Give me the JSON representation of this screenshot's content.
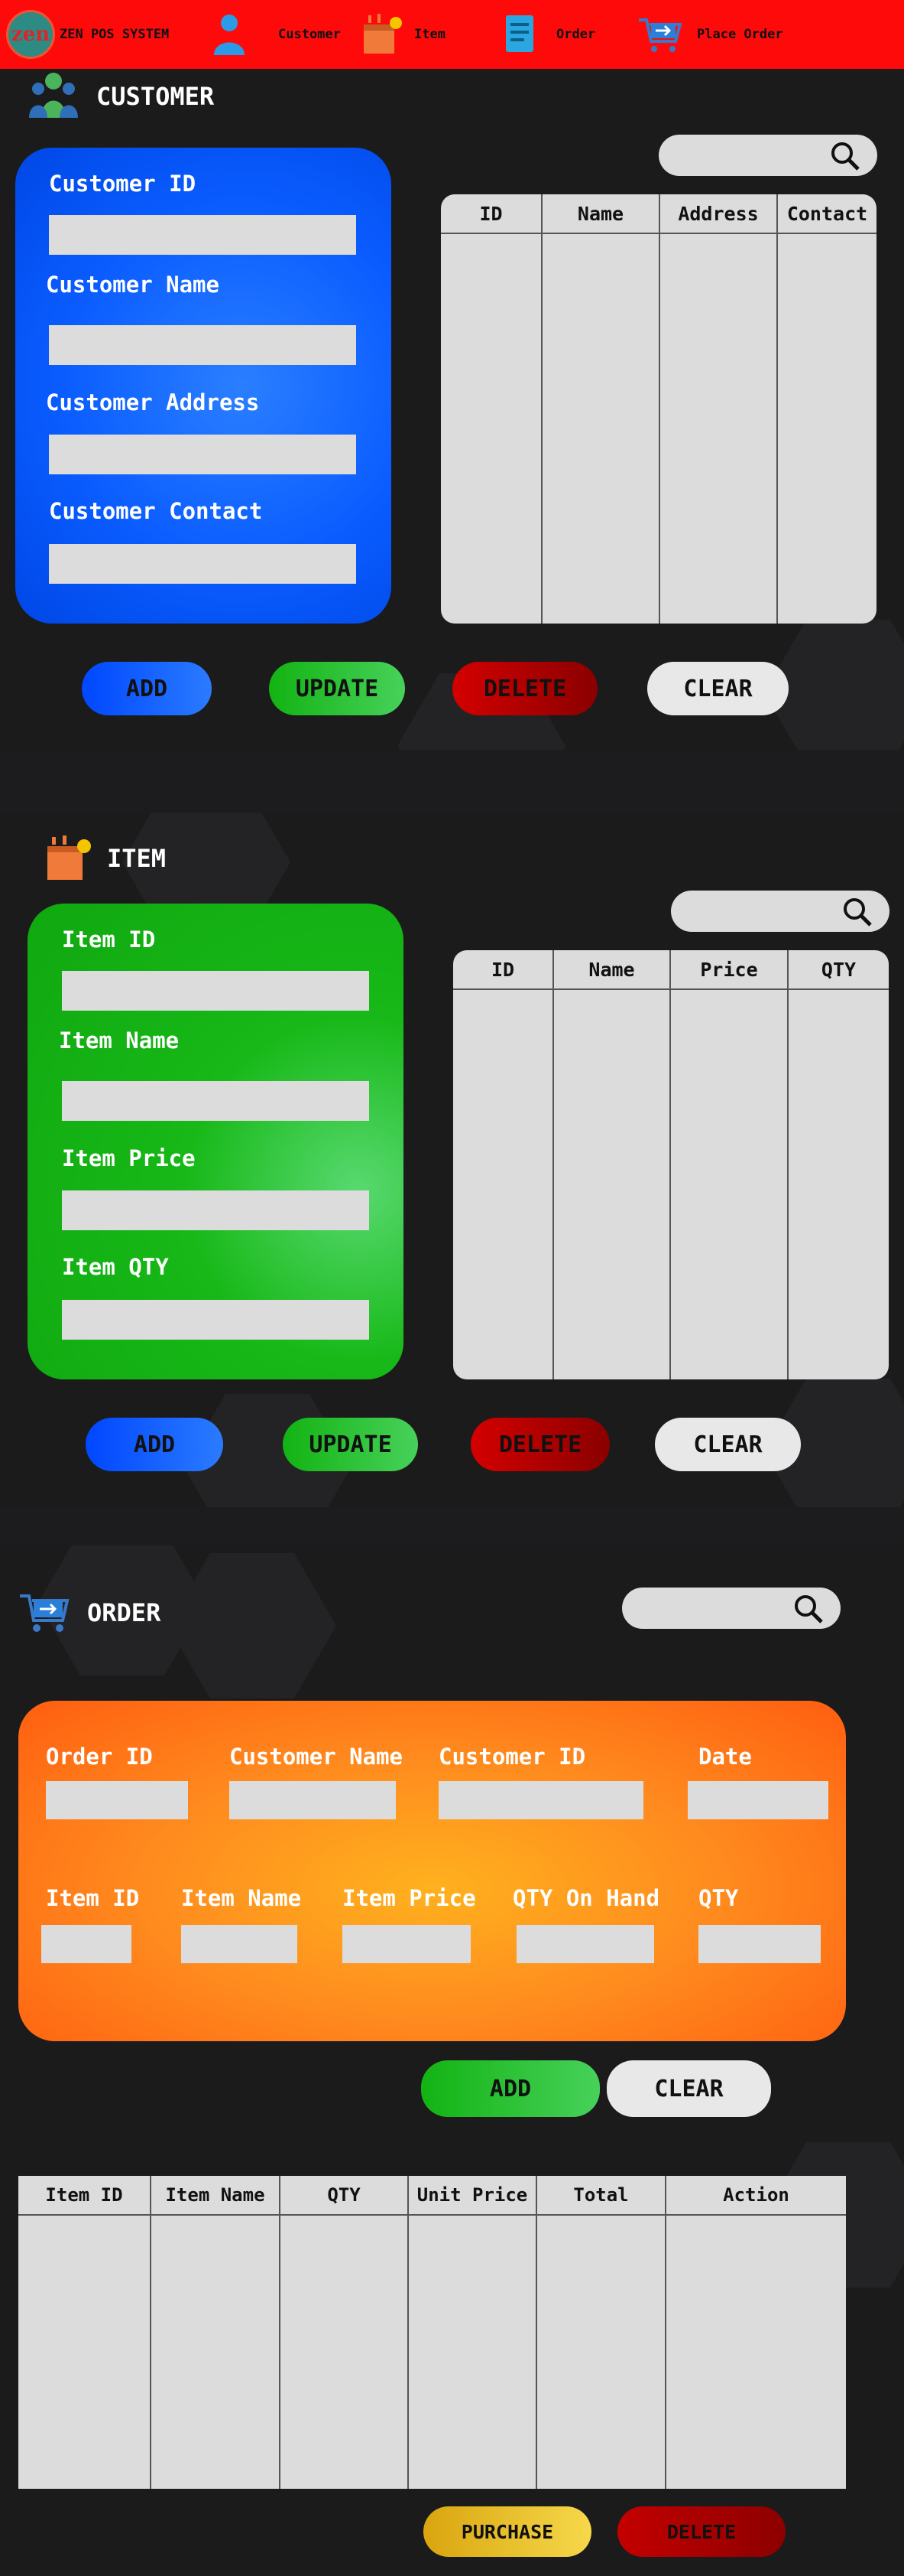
{
  "nav": {
    "logo_text": "zen",
    "brand": "ZEN POS SYSTEM",
    "items": [
      {
        "label": "Customer",
        "icon": "customer-icon"
      },
      {
        "label": "Item",
        "icon": "item-box-icon"
      },
      {
        "label": "Order",
        "icon": "order-doc-icon"
      },
      {
        "label": "Place Order",
        "icon": "place-order-cart-icon"
      }
    ]
  },
  "customer": {
    "title": "CUSTOMER",
    "fields": [
      "Customer ID",
      "Customer Name",
      "Customer Address",
      "Customer Contact"
    ],
    "table_headers": [
      "ID",
      "Name",
      "Address",
      "Contact"
    ],
    "buttons": {
      "add": "ADD",
      "update": "UPDATE",
      "delete": "DELETE",
      "clear": "CLEAR"
    }
  },
  "item": {
    "title": "ITEM",
    "fields": [
      "Item ID",
      "Item Name",
      "Item Price",
      "Item QTY"
    ],
    "table_headers": [
      "ID",
      "Name",
      "Price",
      "QTY"
    ],
    "buttons": {
      "add": "ADD",
      "update": "UPDATE",
      "delete": "DELETE",
      "clear": "CLEAR"
    }
  },
  "order": {
    "title": "ORDER",
    "row1": [
      "Order ID",
      "Customer Name",
      "Customer ID",
      "Date"
    ],
    "row2": [
      "Item ID",
      "Item Name",
      "Item Price",
      "QTY On Hand",
      "QTY"
    ],
    "buttons": {
      "add": "ADD",
      "clear": "CLEAR",
      "purchase": "PURCHASE",
      "delete": "DELETE"
    },
    "table_headers": [
      "Item ID",
      "Item Name",
      "QTY",
      "Unit Price",
      "Total",
      "Action"
    ]
  },
  "colors": {
    "nav_bg": "#fe0a0a",
    "customer_card": "#0a5cff",
    "item_card": "#13b313",
    "order_card": "#ff7a18",
    "page_bg": "#1c1c1e"
  }
}
